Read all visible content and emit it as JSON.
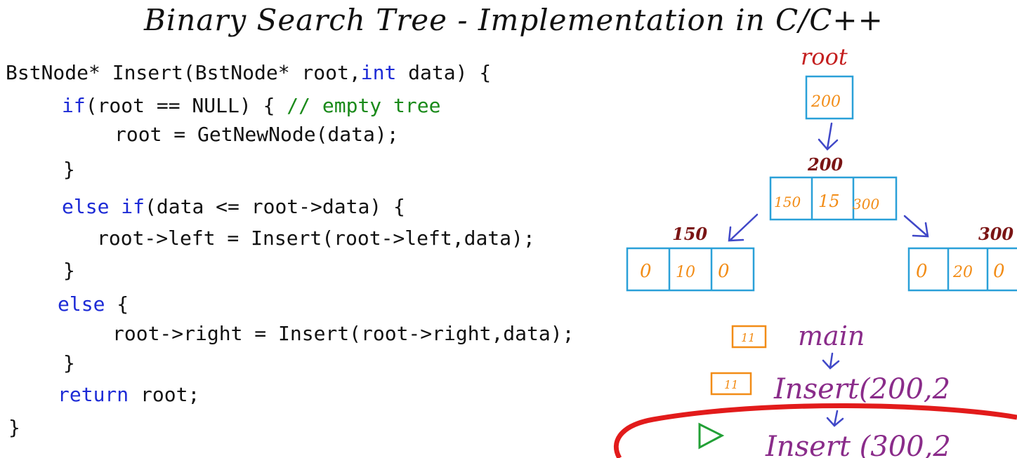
{
  "title": "Binary Search Tree - Implementation in C/C++",
  "code": {
    "line1": {
      "p1": "BstNode* Insert(BstNode* root,",
      "kw1": "int",
      "p2": " data) {"
    },
    "line2": {
      "kw1": "if",
      "p1": "(root == NULL) { ",
      "comment": "// empty tree"
    },
    "line3": {
      "p1": "root = GetNewNode(data);"
    },
    "line4": {
      "p1": "}"
    },
    "line5": {
      "kw1": "else",
      "p1": " ",
      "kw2": "if",
      "p2": "(data <= root->data) {"
    },
    "line6": {
      "p1": "root->left = Insert(root->left,data);"
    },
    "line7": {
      "p1": "}"
    },
    "line8": {
      "kw1": "else",
      "p1": " {"
    },
    "line9": {
      "p1": "root->right = Insert(root->right,data);"
    },
    "line10": {
      "p1": "}"
    },
    "line11": {
      "kw1": "return",
      "p1": " root;"
    },
    "line12": {
      "p1": "}"
    }
  },
  "diagram": {
    "root_label": "root",
    "root_value": "200",
    "node200_addr": "200",
    "node200_cells": [
      "150",
      "15",
      "300"
    ],
    "node150_addr": "150",
    "node150_cells": [
      "0",
      "10",
      "0"
    ],
    "node300_addr": "300",
    "node300_cells": [
      "0",
      "20",
      "0"
    ],
    "stack": {
      "main_badge": "11",
      "main_label": "main",
      "insert1_badge": "11",
      "insert1_label": "Insert(200,2",
      "insert2_label": "Insert (300,2"
    },
    "colors": {
      "root_label": "#c41f1f",
      "address": "#7a1414",
      "pointer": "#f28c16",
      "node_border": "#2aa0d8",
      "arrow": "#4048c8",
      "stack_text": "#8a2c8a",
      "highlight": "#e21b1b",
      "play_marker": "#22a036"
    }
  }
}
